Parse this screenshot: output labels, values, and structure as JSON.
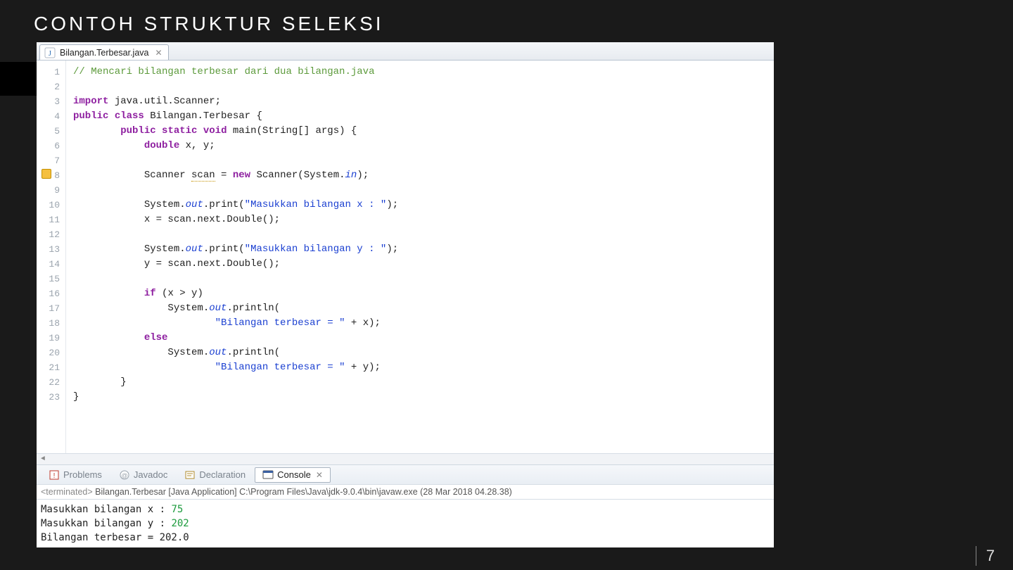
{
  "slide": {
    "title": "CONTOH STRUKTUR SELEKSI",
    "page_number": "7"
  },
  "editor_tab": {
    "filename": "Bilangan.Terbesar.java"
  },
  "code": {
    "line_numbers": [
      "1",
      "2",
      "3",
      "4",
      "5",
      "6",
      "7",
      "8",
      "9",
      "10",
      "11",
      "12",
      "13",
      "14",
      "15",
      "16",
      "17",
      "18",
      "19",
      "20",
      "21",
      "22",
      "23"
    ],
    "l1_comment": "// Mencari bilangan terbesar dari dua bilangan.java",
    "l3_kw_import": "import",
    "l3_rest": " java.util.Scanner;",
    "l4_kw_public": "public",
    "l4_kw_class": "class",
    "l4_name": " Bilangan.Terbesar {",
    "l5_kw_public": "public",
    "l5_kw_static": "static",
    "l5_kw_void": "void",
    "l5_rest": " main(String[] args) {",
    "l6_kw_double": "double",
    "l6_rest": " x, y;",
    "l8_a": "            Scanner ",
    "l8_scan": "scan",
    "l8_b": " = ",
    "l8_kw_new": "new",
    "l8_c": " Scanner(System.",
    "l8_in": "in",
    "l8_d": ");",
    "l10_a": "            System.",
    "l10_out": "out",
    "l10_b": ".print(",
    "l10_str": "\"Masukkan bilangan x : \"",
    "l10_c": ");",
    "l11": "            x = scan.next.Double();",
    "l13_a": "            System.",
    "l13_out": "out",
    "l13_b": ".print(",
    "l13_str": "\"Masukkan bilangan y : \"",
    "l13_c": ");",
    "l14": "            y = scan.next.Double();",
    "l16_kw_if": "if",
    "l16_rest": " (x > y)",
    "l17_a": "                System.",
    "l17_out": "out",
    "l17_b": ".println(",
    "l18_a": "                        ",
    "l18_str": "\"Bilangan terbesar = \"",
    "l18_b": " + x);",
    "l19_kw_else": "else",
    "l20_a": "                System.",
    "l20_out": "out",
    "l20_b": ".println(",
    "l21_a": "                        ",
    "l21_str": "\"Bilangan terbesar = \"",
    "l21_b": " + y);",
    "l22": "        }",
    "l23": "}"
  },
  "bottom_tabs": {
    "problems": "Problems",
    "javadoc": "Javadoc",
    "declaration": "Declaration",
    "console": "Console"
  },
  "console": {
    "status_prefix": "<terminated>",
    "status_rest": " Bilangan.Terbesar [Java Application] C:\\Program Files\\Java\\jdk-9.0.4\\bin\\javaw.exe (28 Mar 2018 04.28.38)",
    "line1_label": "Masukkan bilangan x : ",
    "line1_value": "75",
    "line2_label": "Masukkan bilangan y : ",
    "line2_value": "202",
    "line3": "Bilangan terbesar = 202.0"
  }
}
